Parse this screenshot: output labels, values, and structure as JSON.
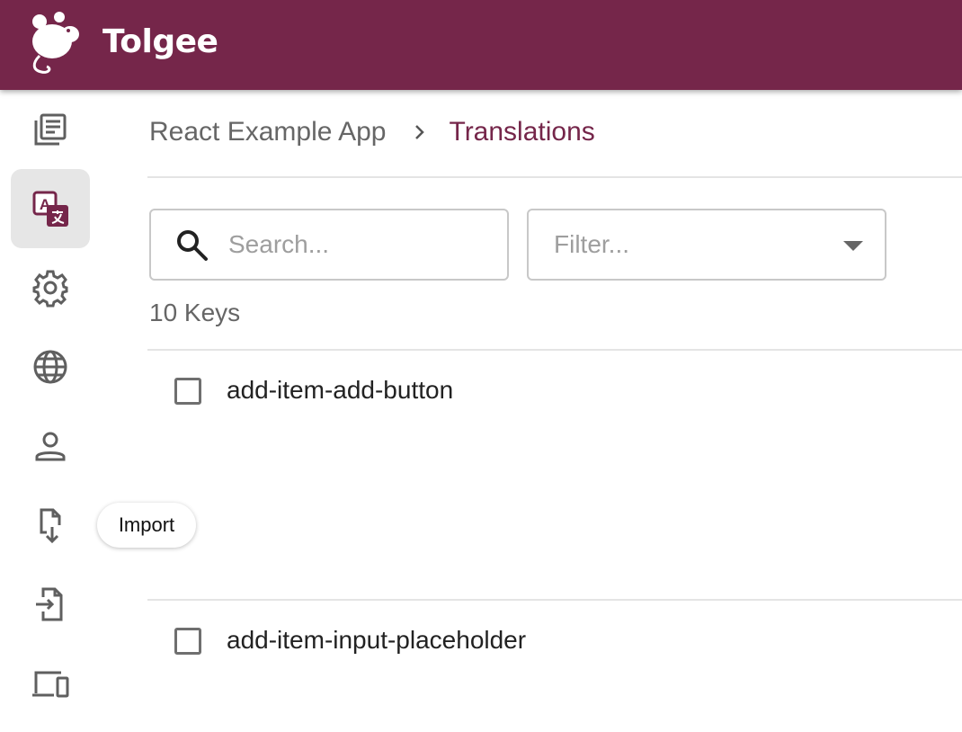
{
  "app": {
    "name": "Tolgee",
    "brand_color": "#75264a"
  },
  "sidebar": {
    "items": [
      {
        "icon": "projects-icon",
        "active": false
      },
      {
        "icon": "translations-icon",
        "active": true
      },
      {
        "icon": "settings-icon",
        "active": false
      },
      {
        "icon": "languages-icon",
        "active": false
      },
      {
        "icon": "members-icon",
        "active": false
      },
      {
        "icon": "import-icon",
        "active": false
      },
      {
        "icon": "export-icon",
        "active": false
      },
      {
        "icon": "integrate-icon",
        "active": false
      }
    ],
    "tooltip": "Import"
  },
  "breadcrumb": {
    "project": "React Example App",
    "current": "Translations"
  },
  "toolbar": {
    "search_placeholder": "Search...",
    "filter_placeholder": "Filter..."
  },
  "keys": {
    "count_label": "10 Keys",
    "items": [
      {
        "name": "add-item-add-button"
      },
      {
        "name": "add-item-input-placeholder"
      }
    ]
  }
}
